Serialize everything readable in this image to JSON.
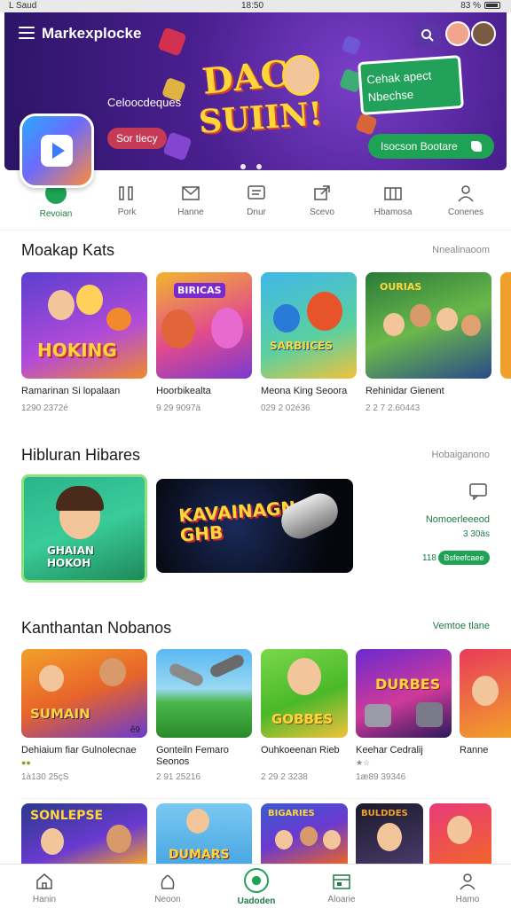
{
  "status_bar": {
    "carrier": "L Saud",
    "time": "18:50",
    "right": "83 %"
  },
  "header": {
    "app_name": "Markexplocke"
  },
  "hero": {
    "tagline": "Celoocdeques",
    "see_button": "Sor tiecy",
    "promo_title": "Cehak apect",
    "promo_sub": "Nbechse",
    "cta_button": "Isocson Bootare",
    "logo_line1": "DAC",
    "logo_line2": "SUIIN!"
  },
  "categories": [
    {
      "label": "Revoian",
      "icon": "gamepad-icon",
      "active": true
    },
    {
      "label": "Pork",
      "icon": "bars-icon"
    },
    {
      "label": "Hanne",
      "icon": "envelope-icon"
    },
    {
      "label": "Dnur",
      "icon": "chat-icon"
    },
    {
      "label": "Scevo",
      "icon": "share-icon"
    },
    {
      "label": "Hbamosa",
      "icon": "columns-icon"
    },
    {
      "label": "Conenes",
      "icon": "person-icon"
    }
  ],
  "section1": {
    "title": "Moakap Kats",
    "link": "Nnealinaoom",
    "items": [
      {
        "title": "Ramarinan Si lopalaan",
        "meta": "1290 2372é",
        "art": "HOKING"
      },
      {
        "title": "Hoorbikealta",
        "meta": "9 29 9097ä",
        "art": "BIRICAS"
      },
      {
        "title": "Meona King Seoora",
        "meta": "029 2 02é36",
        "art": "SARBIICES"
      },
      {
        "title": "Rehinidar Gienent",
        "meta": "2 2 7 2.60443",
        "art": "OURIAS"
      }
    ]
  },
  "section2": {
    "title": "Hibluran Hibares",
    "link": "Hobaiganono",
    "card1_art": "GHAIAN HOKOH",
    "card2_art": "KAVAINAGN GHB",
    "side_title": "Nomoerleeeod",
    "side_meta": "3 30äs",
    "side_count": "118",
    "side_button": "Bsfeefcaee"
  },
  "section3": {
    "title": "Kanthantan Nobanos",
    "link": "Vemtoe tlane",
    "items": [
      {
        "title": "Dehiaium fiar Gulnolecnae",
        "meta": "1à130 25çS",
        "badge": "ê9",
        "art": "SUMAIN"
      },
      {
        "title": "Gonteiln Femaro Seonos",
        "meta": "2 91 25216",
        "art": ""
      },
      {
        "title": "Ouhkoeenan Rieb",
        "meta": "2 29 2 3238",
        "art": "GOBBES"
      },
      {
        "title": "Keehar Cedralij",
        "meta": "1æ89 39346",
        "art": "DURBES"
      },
      {
        "title": "Ranne",
        "meta": "",
        "art": ""
      }
    ]
  },
  "section4": {
    "arts": [
      "SONLEPSE",
      "DUMARS",
      "BIGARIES",
      "BULDDES",
      ""
    ]
  },
  "bottom_nav": [
    {
      "label": "Hanin",
      "icon": "home-icon"
    },
    {
      "label": "Neoon",
      "icon": "bag-icon"
    },
    {
      "label": "Uadoden",
      "icon": "compass-icon",
      "active": true
    },
    {
      "label": "Aloarie",
      "icon": "gallery-icon"
    },
    {
      "label": "Hamo",
      "icon": "profile-icon"
    }
  ],
  "colors": {
    "accent": "#1ea355",
    "hero": "#4a1f8f",
    "cta_red": "#c73a55"
  }
}
